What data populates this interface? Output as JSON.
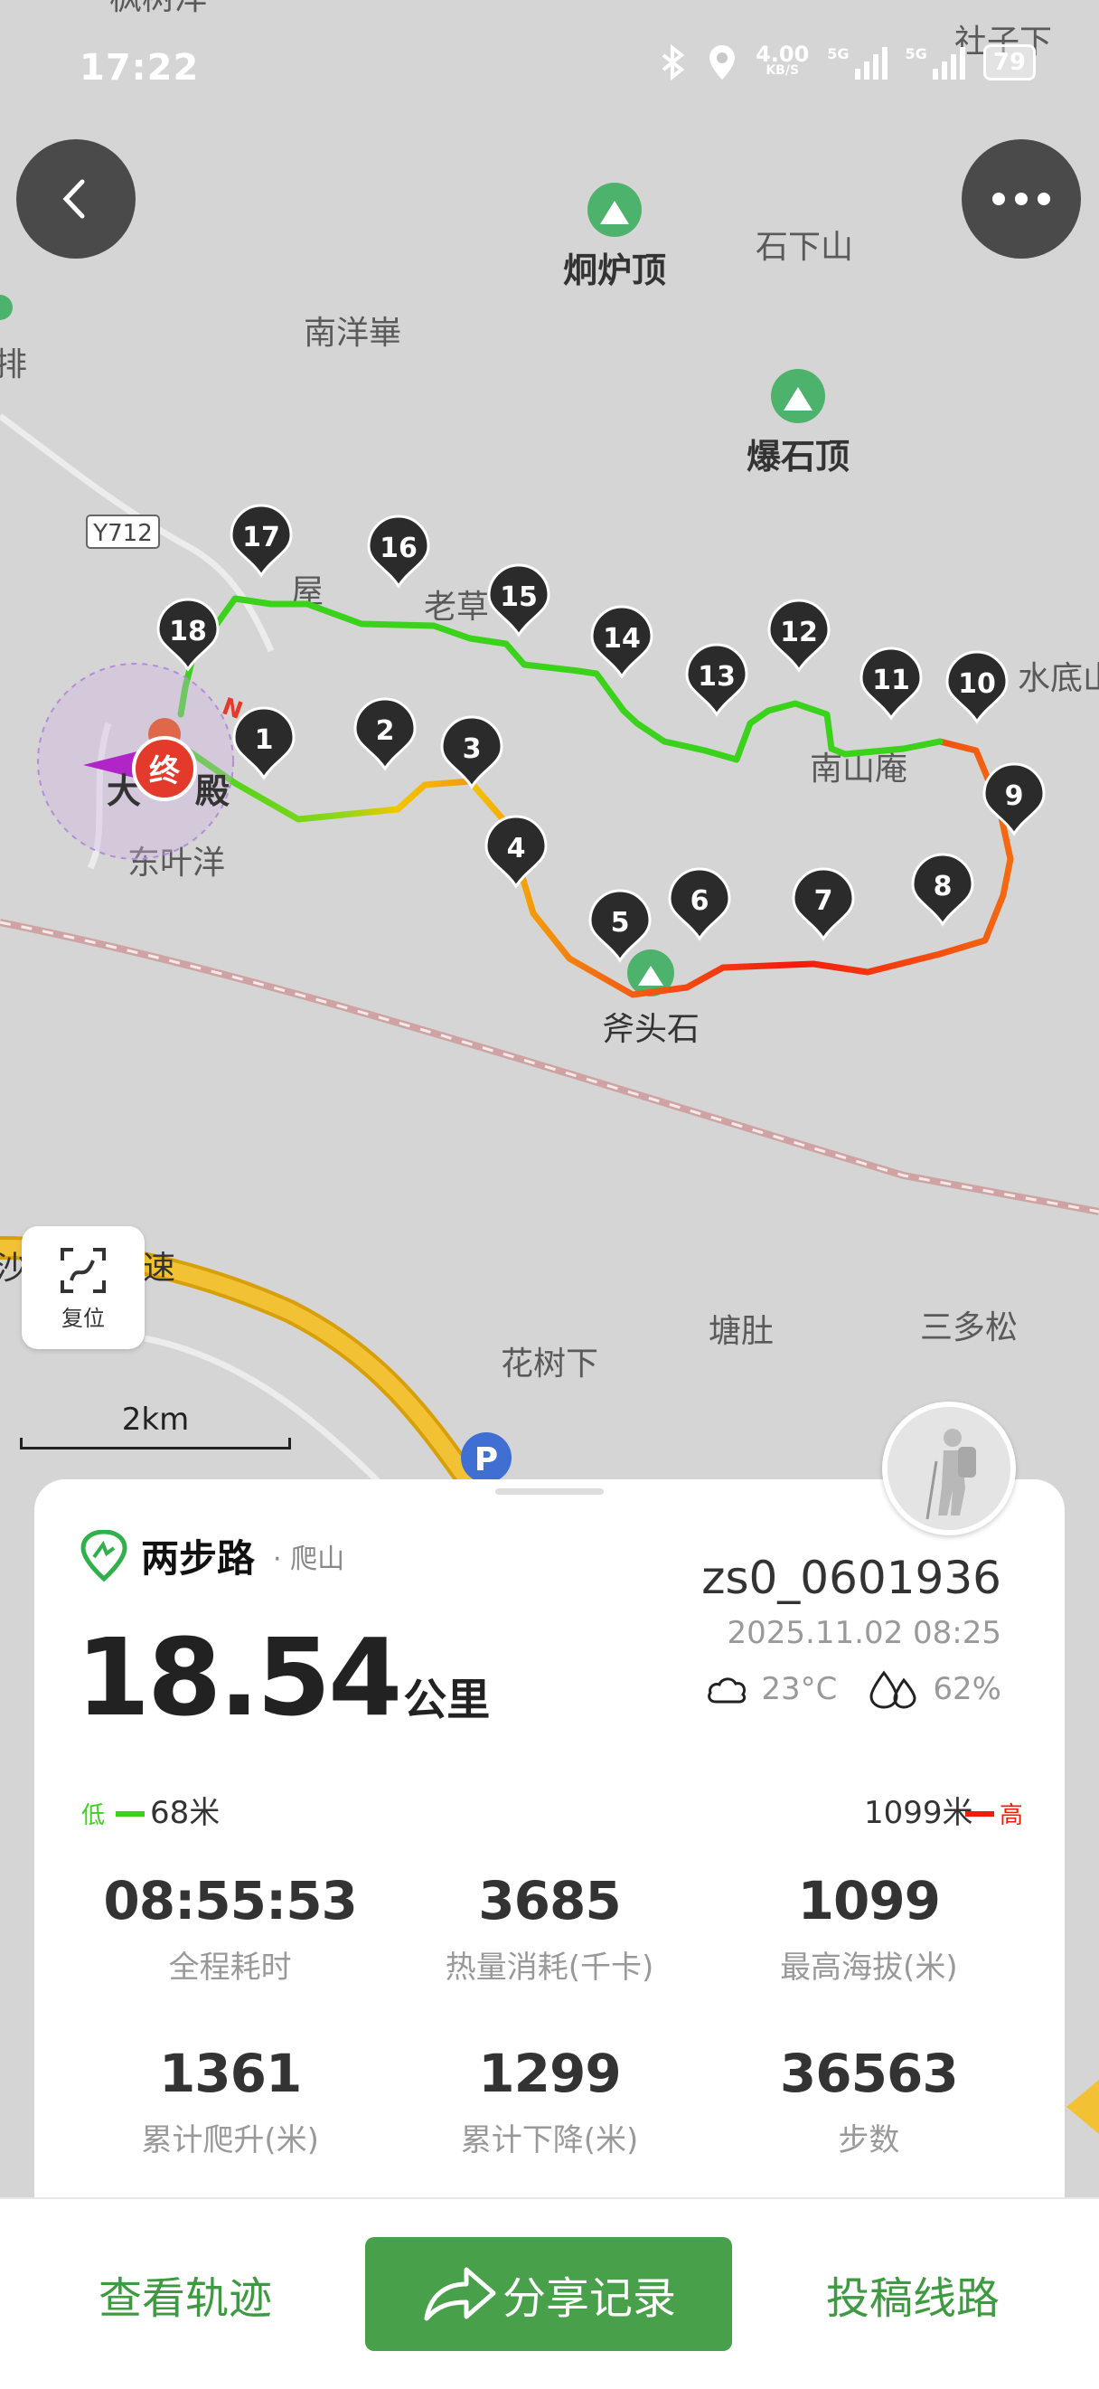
{
  "status_bar": {
    "time": "17:22",
    "net_speed_value": "4.00",
    "net_speed_unit": "KB/S",
    "signal_label": "5G",
    "battery": "79"
  },
  "map": {
    "scale": "2km",
    "reset_label": "复位",
    "labels": [
      "枫树洋",
      "社子下",
      "排",
      "南洋崋",
      "石下山",
      "Y712",
      "东叶洋",
      "南山庵",
      "水底山",
      "斧头石",
      "塘肚",
      "三多松",
      "花树下",
      "速",
      "沙"
    ],
    "peaks": [
      "炯炉顶",
      "爆石顶"
    ],
    "start_label": "大",
    "start_suffix": "殿",
    "end_badge": "终",
    "north": "N",
    "waypoints": [
      "1",
      "2",
      "3",
      "4",
      "5",
      "6",
      "7",
      "8",
      "9",
      "10",
      "11",
      "12",
      "13",
      "14",
      "15",
      "16",
      "17",
      "18"
    ],
    "building_labels": [
      "屋",
      "老草"
    ],
    "route_colors": {
      "low": "#3ad21a",
      "mid": "#f5c400",
      "high": "#f41a0e"
    }
  },
  "card": {
    "brand": "两步路",
    "activity": "· 爬山",
    "username": "zs0_0601936",
    "datetime": "2025.11.02 08:25",
    "temperature": "23°C",
    "humidity": "62%",
    "distance": "18.54",
    "distance_unit": "公里",
    "legend": {
      "low": "低",
      "low_value": "68米",
      "high_value": "1099米",
      "high": "高"
    },
    "stats": [
      {
        "value": "08:55:53",
        "label": "全程耗时"
      },
      {
        "value": "3685",
        "label": "热量消耗(千卡)"
      },
      {
        "value": "1099",
        "label": "最高海拔(米)"
      },
      {
        "value": "1361",
        "label": "累计爬升(米)"
      },
      {
        "value": "1299",
        "label": "累计下降(米)"
      },
      {
        "value": "36563",
        "label": "步数"
      }
    ]
  },
  "bottom_bar": {
    "track": "查看轨迹",
    "share": "分享记录",
    "submit": "投稿线路"
  }
}
